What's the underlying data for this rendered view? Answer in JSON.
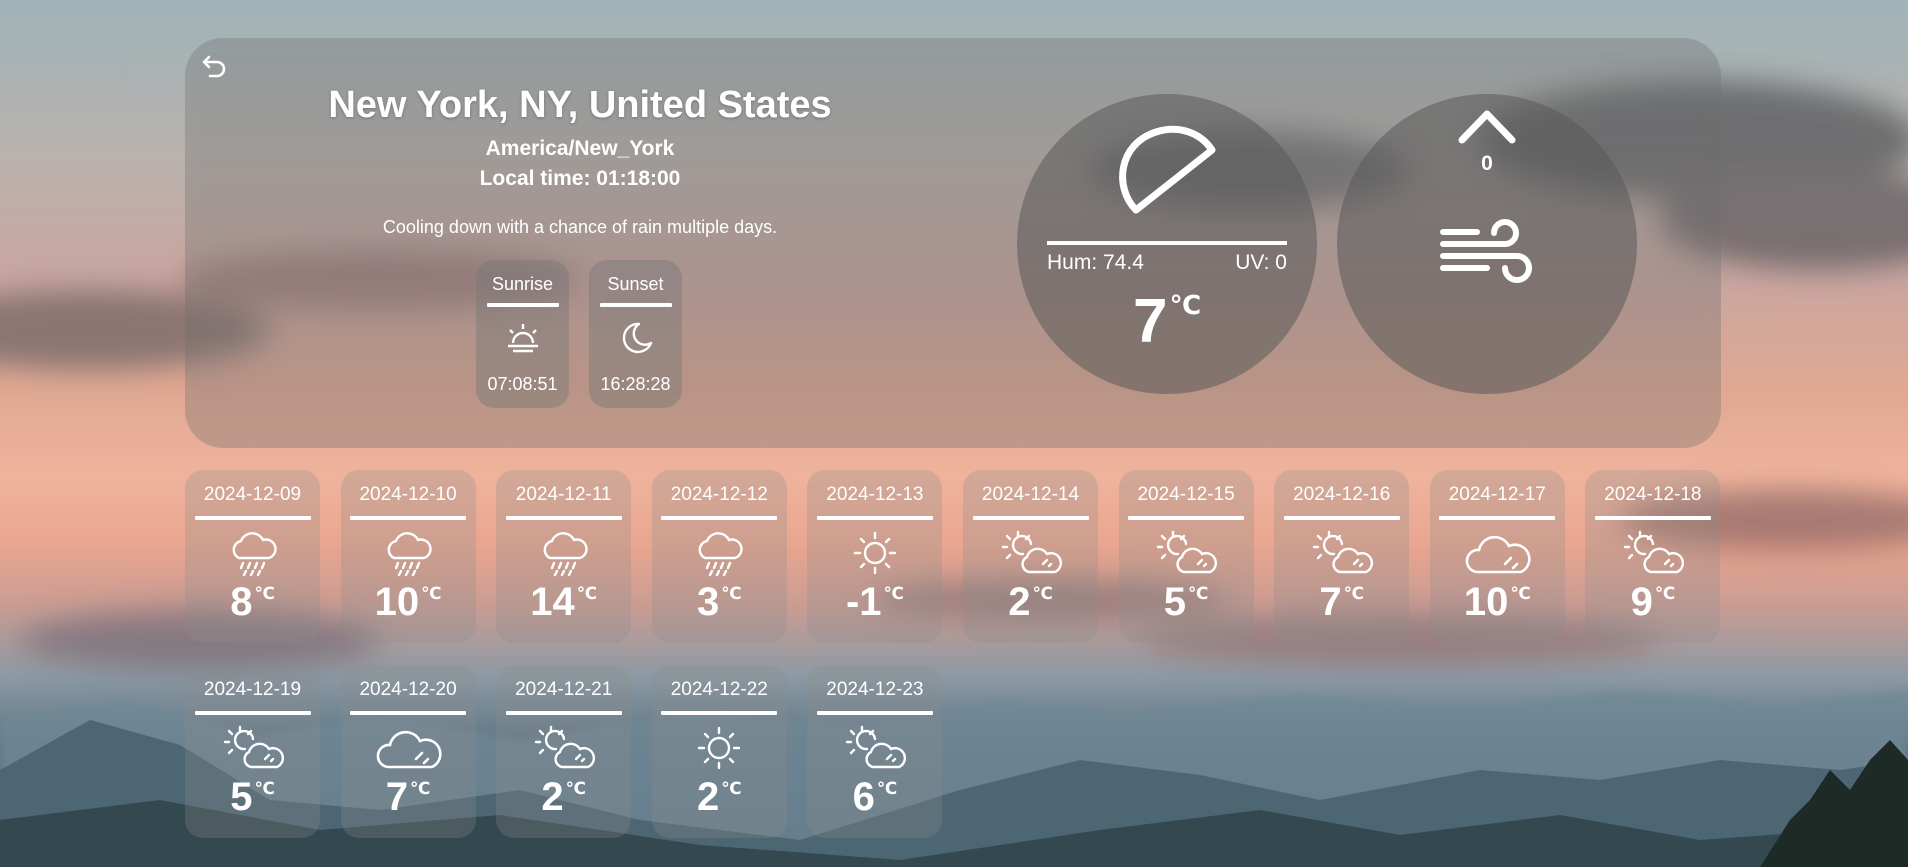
{
  "location": {
    "city": "New York, NY, United States",
    "timezone": "America/New_York",
    "local_time": "Local time: 01:18:00",
    "summary": "Cooling down with a chance of rain multiple days."
  },
  "sun": {
    "sunrise_label": "Sunrise",
    "sunrise_time": "07:08:51",
    "sunset_label": "Sunset",
    "sunset_time": "16:28:28"
  },
  "current": {
    "humidity": "Hum: 74.4",
    "uv": "UV: 0",
    "temp": "7",
    "unit": "℃",
    "moon_icon": "half-moon-icon"
  },
  "wind": {
    "speed": "0",
    "direction_icon": "chevron-up-icon",
    "icon": "wind-icon"
  },
  "forecast": [
    {
      "date": "2024-12-09",
      "temp": "8",
      "icon": "rain"
    },
    {
      "date": "2024-12-10",
      "temp": "10",
      "icon": "rain"
    },
    {
      "date": "2024-12-11",
      "temp": "14",
      "icon": "rain"
    },
    {
      "date": "2024-12-12",
      "temp": "3",
      "icon": "rain"
    },
    {
      "date": "2024-12-13",
      "temp": "-1",
      "icon": "sun"
    },
    {
      "date": "2024-12-14",
      "temp": "2",
      "icon": "partly-cloudy"
    },
    {
      "date": "2024-12-15",
      "temp": "5",
      "icon": "partly-cloudy"
    },
    {
      "date": "2024-12-16",
      "temp": "7",
      "icon": "partly-cloudy"
    },
    {
      "date": "2024-12-17",
      "temp": "10",
      "icon": "cloud"
    },
    {
      "date": "2024-12-18",
      "temp": "9",
      "icon": "partly-cloudy"
    },
    {
      "date": "2024-12-19",
      "temp": "5",
      "icon": "partly-cloudy"
    },
    {
      "date": "2024-12-20",
      "temp": "7",
      "icon": "cloud"
    },
    {
      "date": "2024-12-21",
      "temp": "2",
      "icon": "partly-cloudy"
    },
    {
      "date": "2024-12-22",
      "temp": "2",
      "icon": "sun"
    },
    {
      "date": "2024-12-23",
      "temp": "6",
      "icon": "partly-cloudy"
    }
  ]
}
